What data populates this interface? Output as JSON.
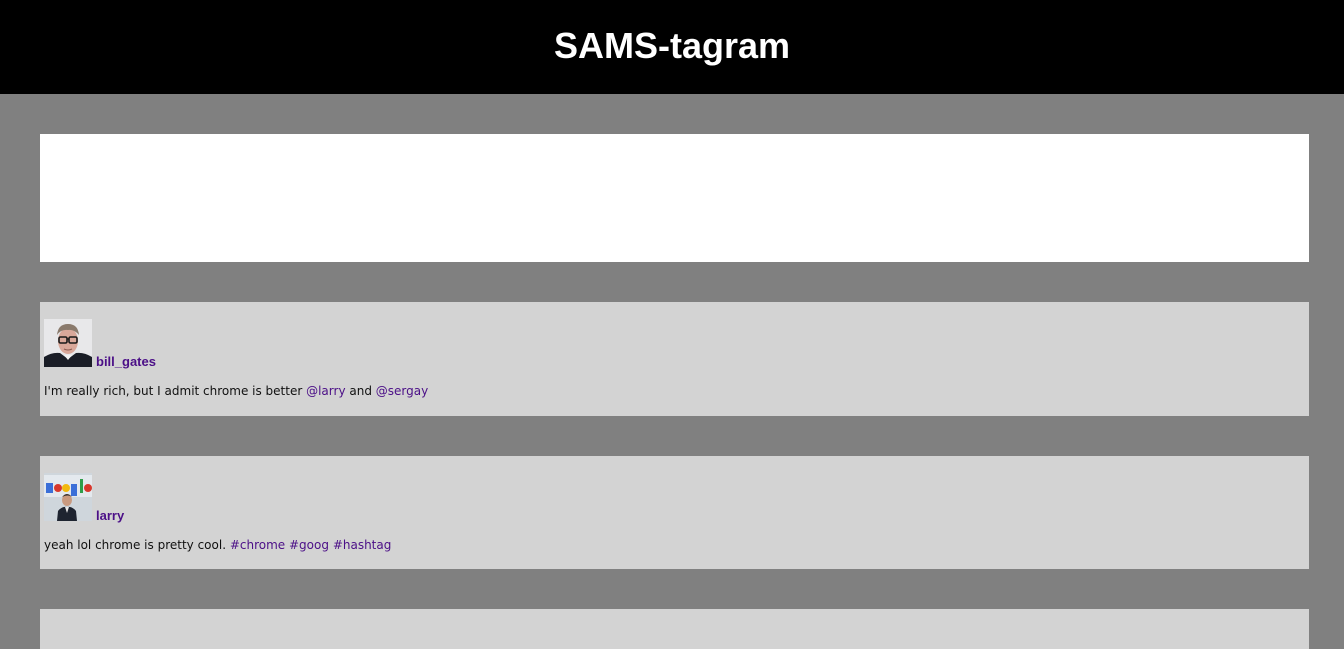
{
  "app": {
    "title": "SAMS-tagram"
  },
  "colors": {
    "header_bg": "#000000",
    "page_bg": "#808080",
    "composer_bg": "#ffffff",
    "post_bg": "#d3d3d3",
    "link": "#4b0f87"
  },
  "posts": [
    {
      "username": "bill_gates",
      "avatar": "bill-gates-avatar",
      "text_parts": [
        {
          "text": "I'm really rich, but I admit chrome is better ",
          "link": false
        },
        {
          "text": "@larry",
          "link": true
        },
        {
          "text": " and ",
          "link": false
        },
        {
          "text": "@sergay",
          "link": true
        }
      ]
    },
    {
      "username": "larry",
      "avatar": "larry-avatar",
      "text_parts": [
        {
          "text": "yeah lol chrome is pretty cool. ",
          "link": false
        },
        {
          "text": "#chrome",
          "link": true
        },
        {
          "text": " ",
          "link": false
        },
        {
          "text": "#goog",
          "link": true
        },
        {
          "text": " ",
          "link": false
        },
        {
          "text": "#hashtag",
          "link": true
        }
      ]
    }
  ]
}
